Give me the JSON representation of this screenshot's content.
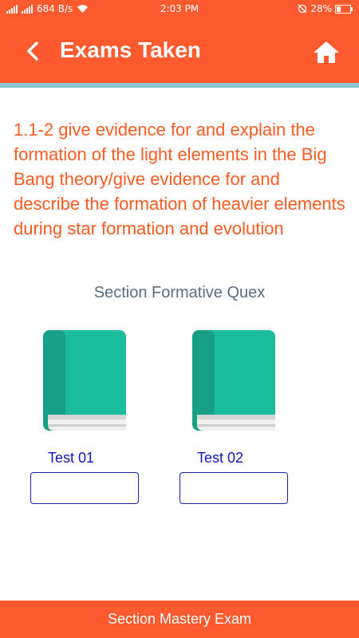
{
  "status_bar": {
    "speed": "684 B/s",
    "time": "2:03 PM",
    "battery": "28%"
  },
  "header": {
    "title": "Exams Taken",
    "back_icon": "chevron-left-icon",
    "home_icon": "home-icon"
  },
  "topic": "1.1-2 give evidence for and explain the formation of the light elements in the Big Bang theory/give evidence for and describe the formation of heavier elements during star formation and evolution",
  "section_title": "Section Formative Quex",
  "tests": [
    {
      "label": "Test 01",
      "value": ""
    },
    {
      "label": "Test 02",
      "value": ""
    }
  ],
  "footer": {
    "button_label": "Section Mastery Exam"
  },
  "colors": {
    "primary": "#ff5a2d",
    "book": "#1abc9c",
    "test_label": "#1212c8"
  }
}
